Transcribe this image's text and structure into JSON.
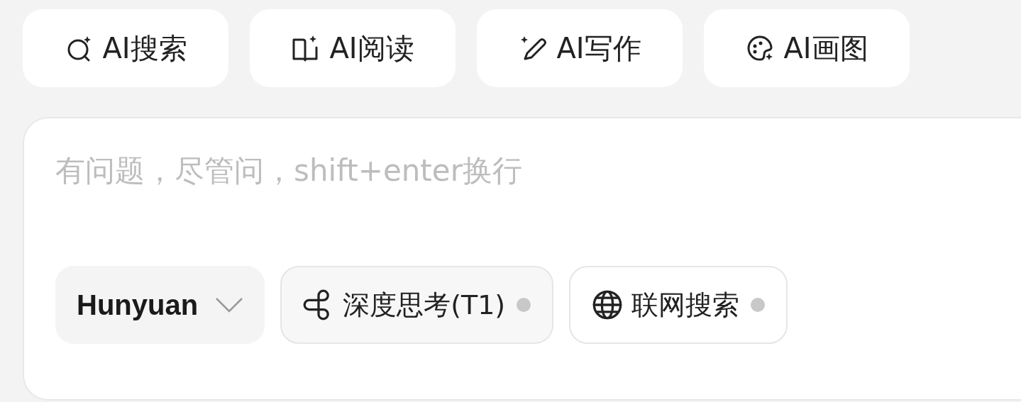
{
  "quick_actions": [
    {
      "kind": "search",
      "label": "AI搜索"
    },
    {
      "kind": "read",
      "label": "AI阅读"
    },
    {
      "kind": "write",
      "label": "AI写作"
    },
    {
      "kind": "draw",
      "label": "AI画图"
    }
  ],
  "composer": {
    "placeholder": "有问题，尽管问，shift+enter换行",
    "model": {
      "label": "Hunyuan"
    },
    "toggles": [
      {
        "kind": "think",
        "label": "深度思考(T1)",
        "on": false
      },
      {
        "kind": "web",
        "label": "联网搜索",
        "on": false
      }
    ]
  }
}
